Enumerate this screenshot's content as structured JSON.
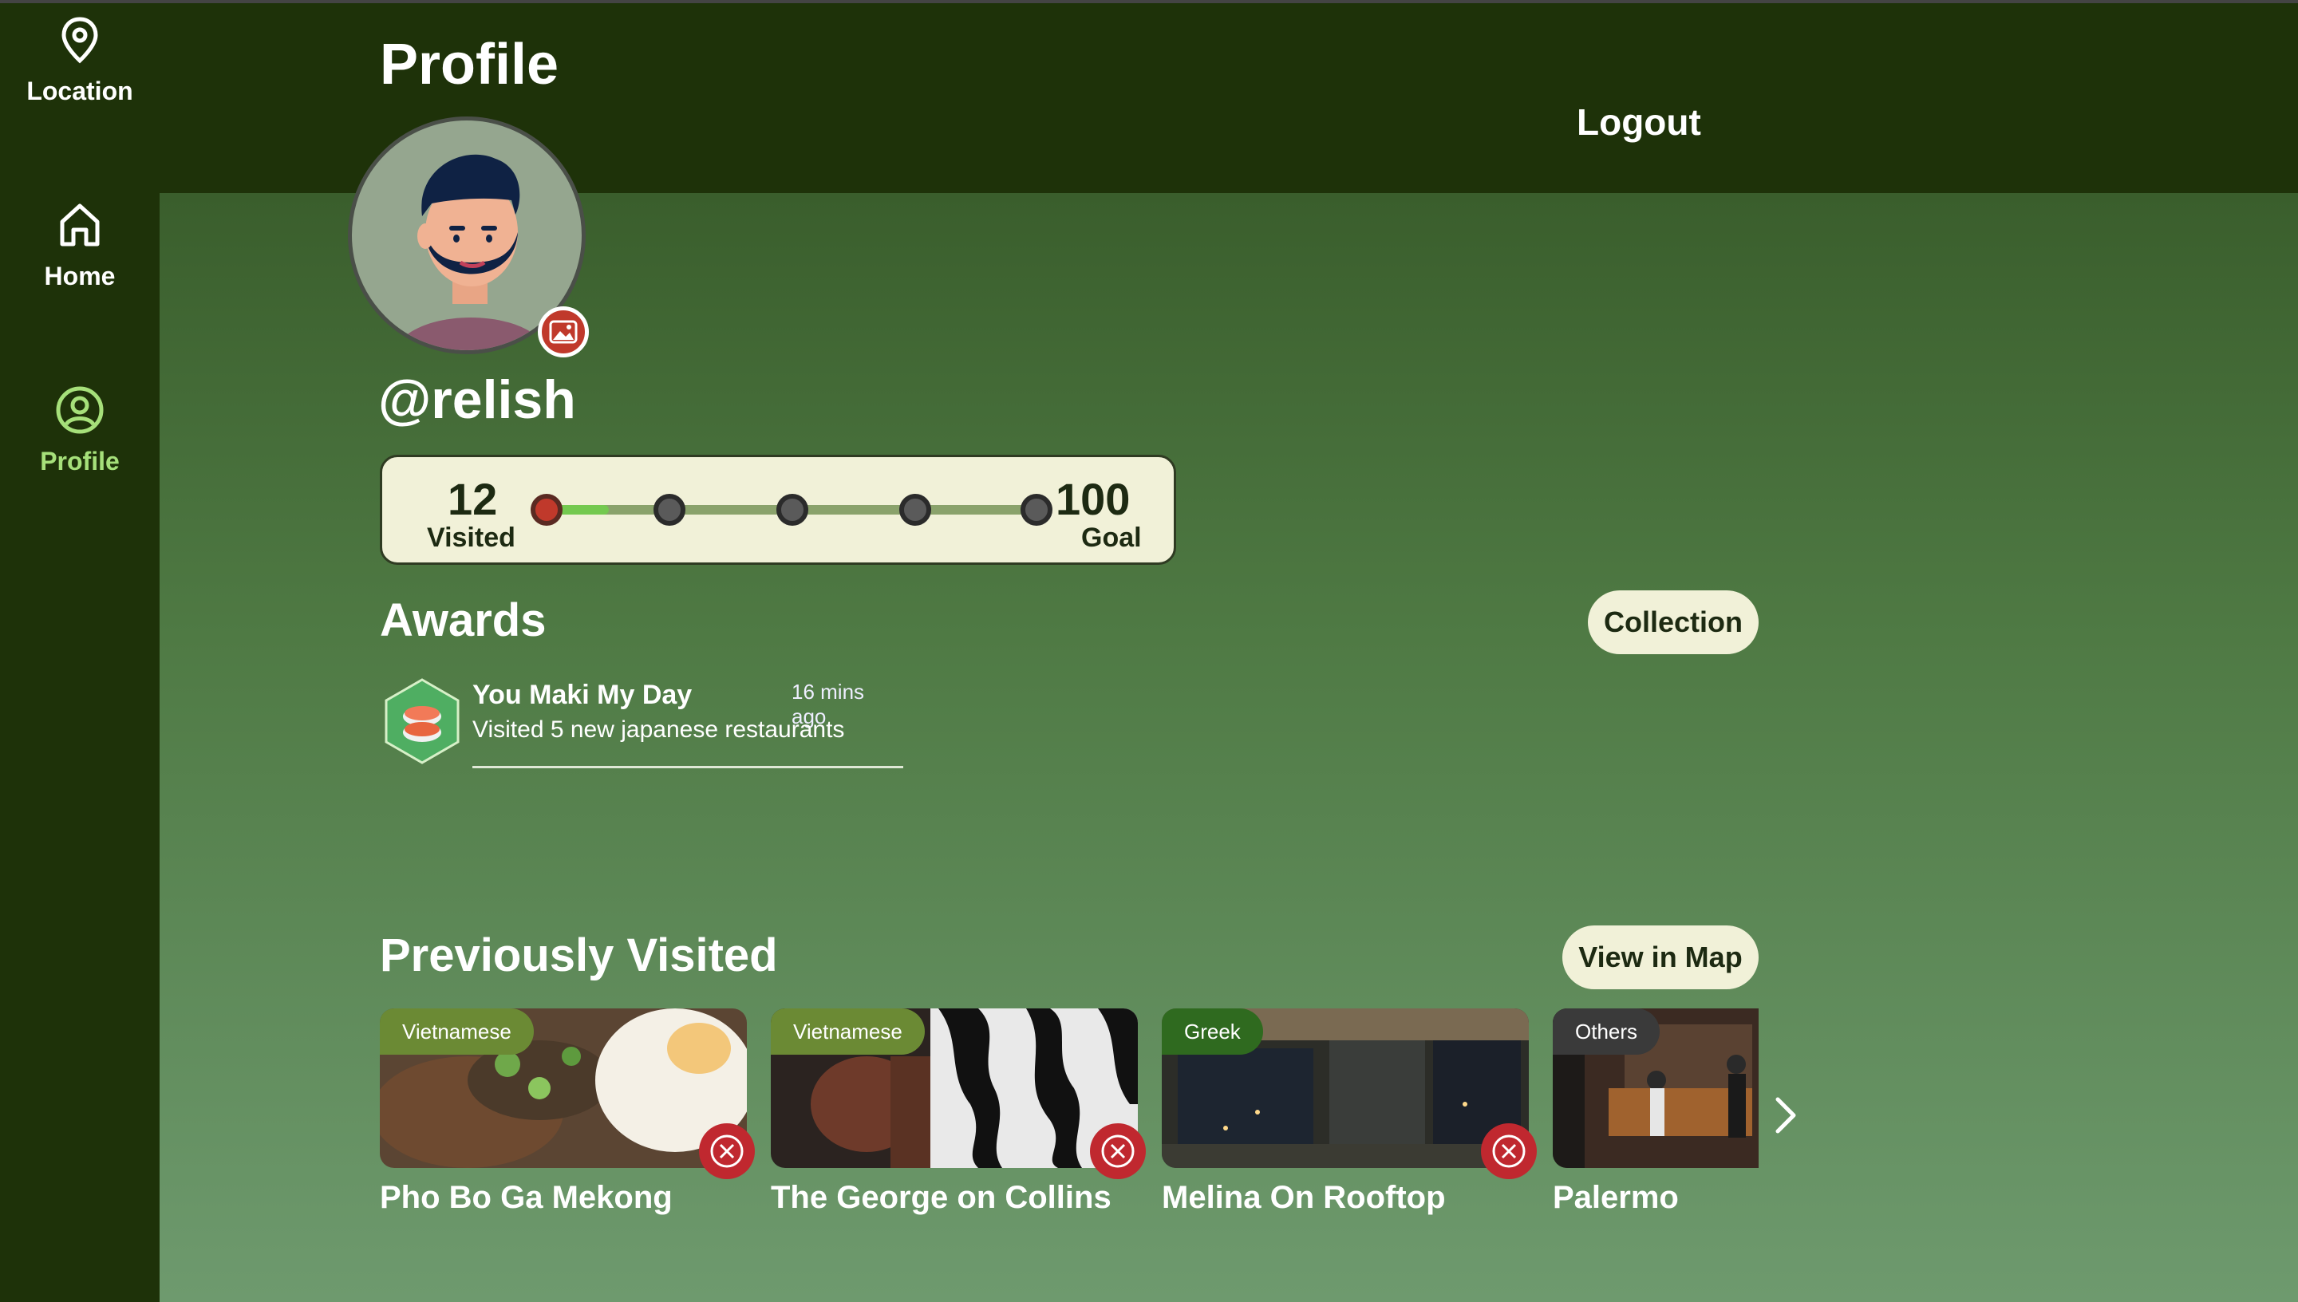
{
  "nav": {
    "items": [
      {
        "label": "Location",
        "icon": "map-pin-icon"
      },
      {
        "label": "Home",
        "icon": "home-icon"
      },
      {
        "label": "Profile",
        "icon": "user-circle-icon"
      }
    ],
    "active": "Profile"
  },
  "header": {
    "title": "Profile",
    "logout_label": "Logout"
  },
  "profile": {
    "username": "@relish",
    "visited_count": "12",
    "visited_label": "Visited",
    "goal_count": "100",
    "goal_label": "Goal",
    "progress_fraction": 0.12
  },
  "awards": {
    "title": "Awards",
    "collection_label": "Collection",
    "items": [
      {
        "name": "You Maki My Day",
        "time": "16 mins ago",
        "description": "Visited 5 new japanese restaurants",
        "icon": "sushi-badge-icon"
      }
    ]
  },
  "visited": {
    "title": "Previously Visited",
    "map_label": "View in Map",
    "cards": [
      {
        "cuisine": "Vietnamese",
        "name": "Pho Bo Ga Mekong"
      },
      {
        "cuisine": "Vietnamese",
        "name": "The George on Collins"
      },
      {
        "cuisine": "Greek",
        "name": "Melina On Rooftop"
      },
      {
        "cuisine": "Others",
        "name": "Palermo"
      }
    ]
  },
  "colors": {
    "accent": "#a6e07a",
    "sidebar": "#1e3209",
    "card_bg": "#f1f1d8",
    "danger": "#c0282f"
  }
}
